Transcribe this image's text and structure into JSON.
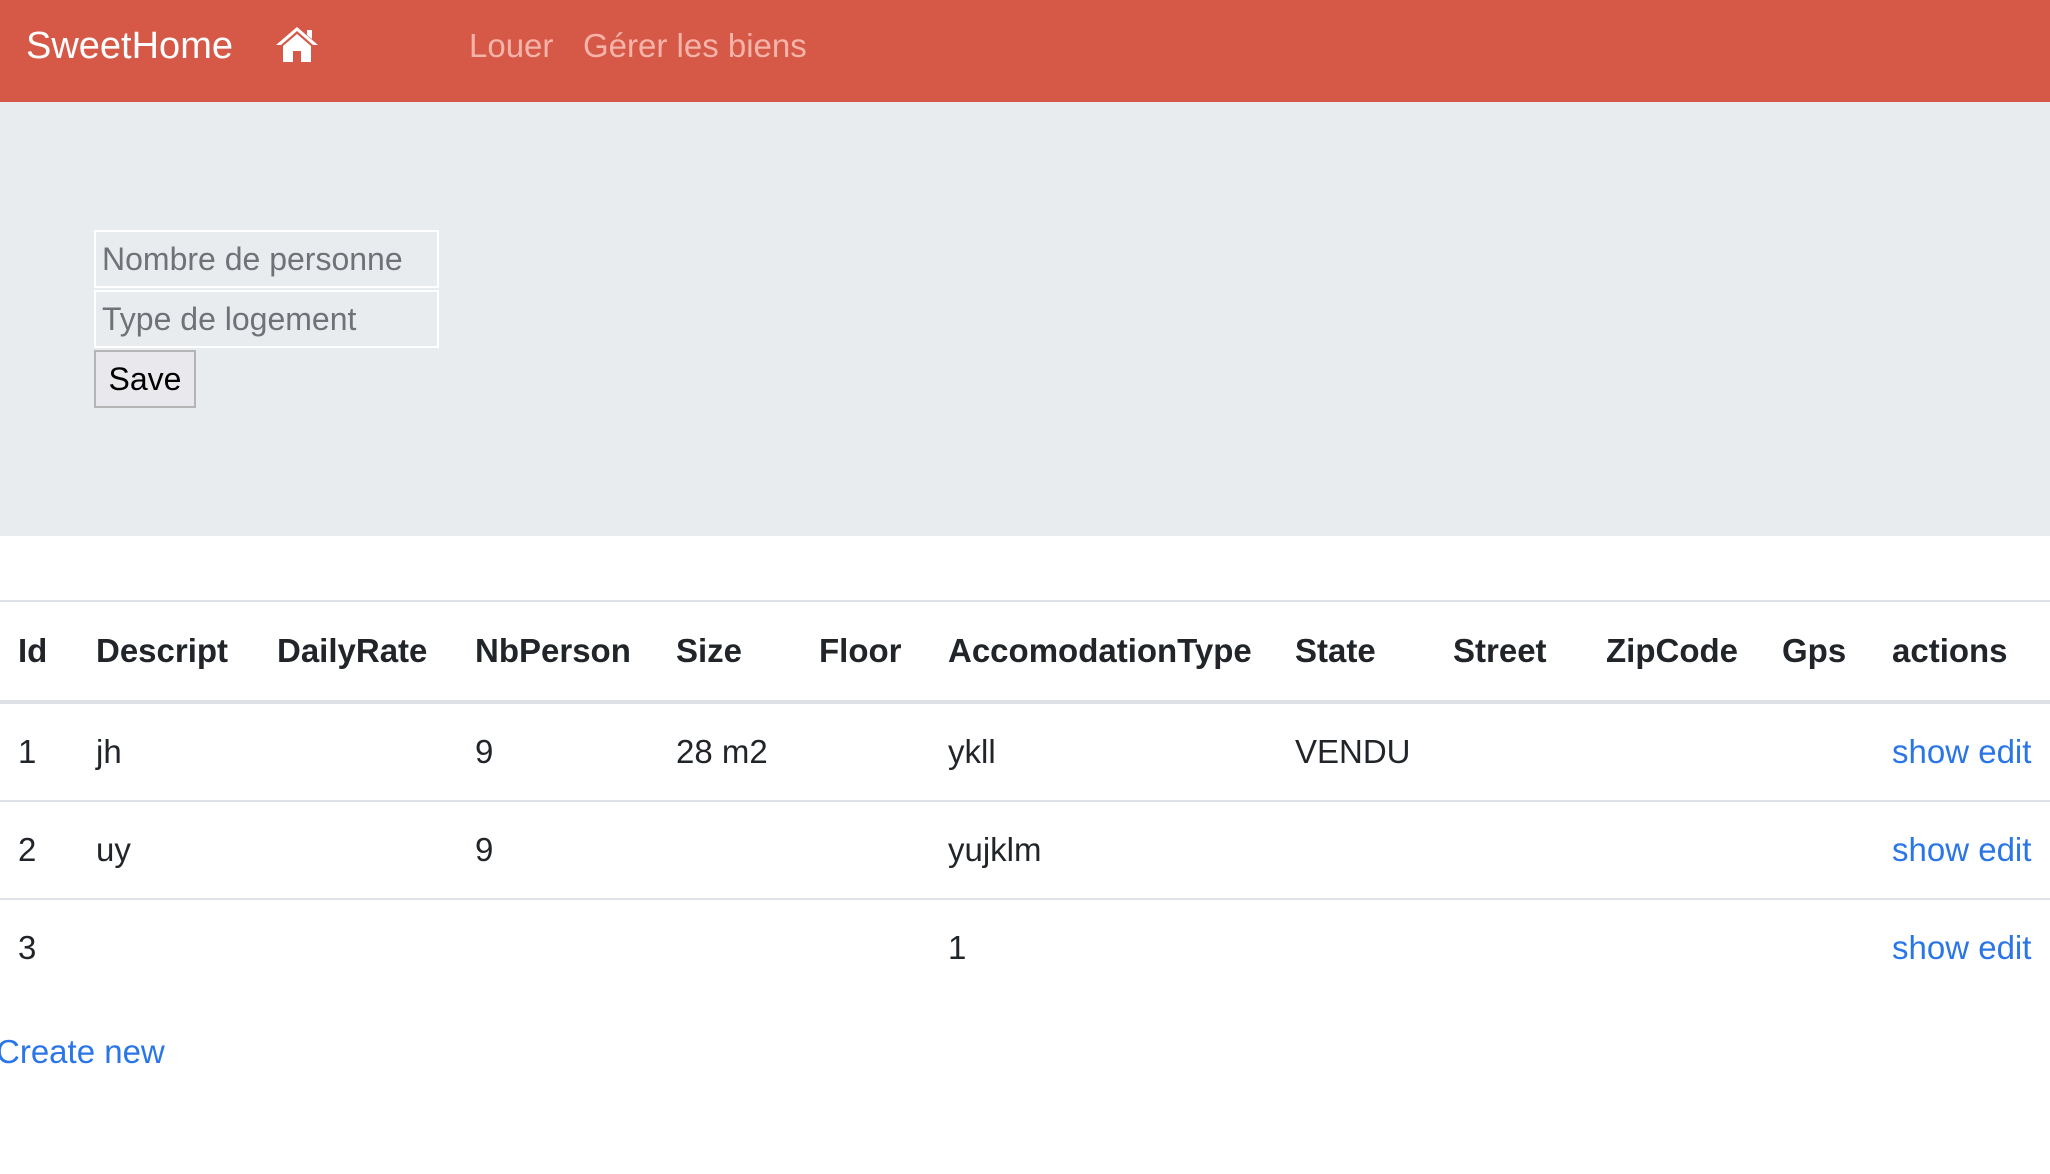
{
  "navbar": {
    "brand": "SweetHome",
    "home_icon": "home-icon",
    "links": [
      "Louer",
      "Gérer les biens"
    ],
    "bg_color": "#d65847"
  },
  "form": {
    "persons_placeholder": "Nombre de personne",
    "type_placeholder": "Type de logement",
    "save_label": "Save"
  },
  "table": {
    "headers": [
      "Id",
      "Descript",
      "DailyRate",
      "NbPerson",
      "Size",
      "Floor",
      "AccomodationType",
      "State",
      "Street",
      "ZipCode",
      "Gps",
      "actions"
    ],
    "rows": [
      {
        "id": "1",
        "descript": "jh",
        "dailyrate": "",
        "nbperson": "9",
        "size": "28 m2",
        "floor": "",
        "type": "ykll",
        "state": "VENDU",
        "street": "",
        "zipcode": "",
        "gps": "",
        "show": "show",
        "edit": "edit"
      },
      {
        "id": "2",
        "descript": "uy",
        "dailyrate": "",
        "nbperson": "9",
        "size": "",
        "floor": "",
        "type": "yujklm",
        "state": "",
        "street": "",
        "zipcode": "",
        "gps": "",
        "show": "show",
        "edit": "edit"
      },
      {
        "id": "3",
        "descript": "",
        "dailyrate": "",
        "nbperson": "",
        "size": "",
        "floor": "",
        "type": "1",
        "state": "",
        "street": "",
        "zipcode": "",
        "gps": "",
        "show": "show",
        "edit": "edit"
      }
    ]
  },
  "create_new": "Create new"
}
